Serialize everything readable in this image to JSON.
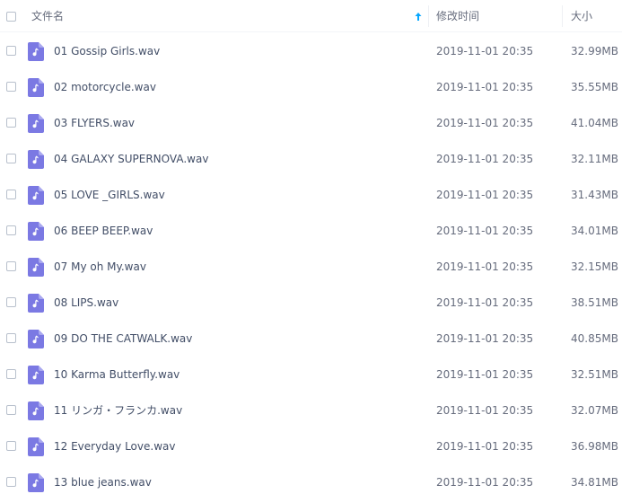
{
  "header": {
    "name_label": "文件名",
    "modified_label": "修改时间",
    "size_label": "大小",
    "sort_icon": "arrow-up-icon"
  },
  "colors": {
    "icon_purple": "#7b79e3",
    "sort_accent": "#06a7ff"
  },
  "files": [
    {
      "name": "01 Gossip Girls.wav",
      "modified": "2019-11-01 20:35",
      "size": "32.99MB"
    },
    {
      "name": "02 motorcycle.wav",
      "modified": "2019-11-01 20:35",
      "size": "35.55MB"
    },
    {
      "name": "03 FLYERS.wav",
      "modified": "2019-11-01 20:35",
      "size": "41.04MB"
    },
    {
      "name": "04 GALAXY SUPERNOVA.wav",
      "modified": "2019-11-01 20:35",
      "size": "32.11MB"
    },
    {
      "name": "05 LOVE _GIRLS.wav",
      "modified": "2019-11-01 20:35",
      "size": "31.43MB"
    },
    {
      "name": "06 BEEP BEEP.wav",
      "modified": "2019-11-01 20:35",
      "size": "34.01MB"
    },
    {
      "name": "07 My oh My.wav",
      "modified": "2019-11-01 20:35",
      "size": "32.15MB"
    },
    {
      "name": "08 LIPS.wav",
      "modified": "2019-11-01 20:35",
      "size": "38.51MB"
    },
    {
      "name": "09 DO THE CATWALK.wav",
      "modified": "2019-11-01 20:35",
      "size": "40.85MB"
    },
    {
      "name": "10 Karma Butterfly.wav",
      "modified": "2019-11-01 20:35",
      "size": "32.51MB"
    },
    {
      "name": "11 リンガ・フランカ.wav",
      "modified": "2019-11-01 20:35",
      "size": "32.07MB"
    },
    {
      "name": "12 Everyday Love.wav",
      "modified": "2019-11-01 20:35",
      "size": "36.98MB"
    },
    {
      "name": "13 blue jeans.wav",
      "modified": "2019-11-01 20:35",
      "size": "34.81MB"
    }
  ]
}
